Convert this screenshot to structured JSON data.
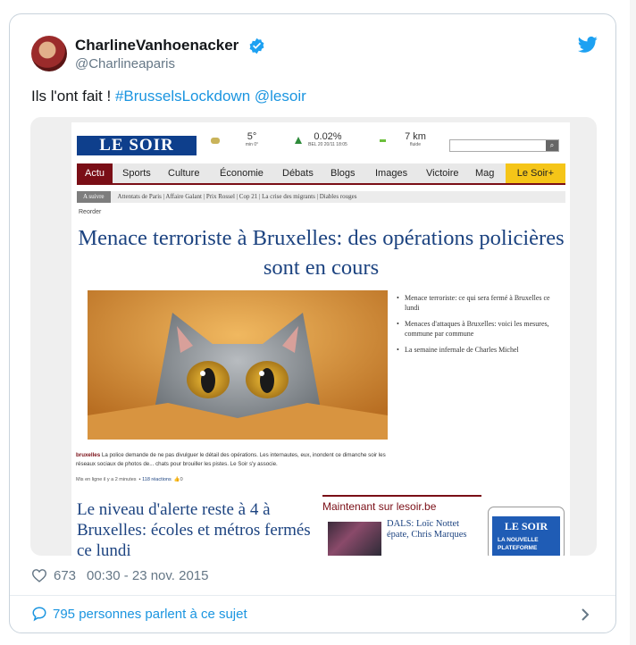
{
  "tweet": {
    "author_name": "CharlineVanhoenacker",
    "handle": "@Charlineaparis",
    "text_prefix": "Ils l'ont fait ! ",
    "hashtag": "#BrusselsLockdown",
    "mention": "@lesoir",
    "like_count": "673",
    "timestamp": "00:30 - 23 nov. 2015",
    "conversation_label": "795 personnes parlent à ce sujet",
    "icons": [
      "verified-badge-icon",
      "twitter-bird-icon",
      "heart-icon",
      "speech-bubble-icon",
      "chevron-right-icon"
    ],
    "colors": {
      "link": "#1b95e0",
      "text": "#14171a",
      "muted": "#657786"
    }
  },
  "screenshot": {
    "logo": "LE SOIR",
    "weather": {
      "temp": "5°",
      "temp_sub": "min 0°",
      "index": "0.02%",
      "index_sub": "BEL 20 20/11 18:05",
      "wind": "7 km",
      "wind_sub": "fluide"
    },
    "nav": [
      "Actu",
      "Sports",
      "Culture",
      "Économie",
      "Débats",
      "Blogs",
      "Images",
      "Victoire",
      "Mag",
      "Le Soir+"
    ],
    "crumbs_label": "A suivre",
    "crumbs": "Attentats de Paris  |  Affaire Galant  |  Prix Rossel  |  Cop 21  |  La crise des migrants  |  Diables rouges",
    "reorder": "Reorder",
    "headline": "Menace terroriste à Bruxelles: des opérations policières sont en cours",
    "related": [
      "Menace terroriste: ce qui sera fermé à Bruxelles ce lundi",
      "Menaces d'attaques à Bruxelles: voici les mesures, commune par commune",
      "La semaine infernale de Charles Michel"
    ],
    "caption_label": "bruxelles",
    "caption": " La police demande de ne pas divulguer le détail des opérations. Les internautes, eux, inondent ce dimanche soir les réseaux sociaux de photos de... chats pour brouiller les pistes. Le Soir s'y associe.",
    "meta_time": "Mis en ligne il y a 2 minutes",
    "meta_reactions": "118 réactions",
    "meta_likes": "0",
    "headline2": "Le niveau d'alerte reste à 4 à Bruxelles: écoles et métros fermés ce lundi",
    "now_on": "Maintenant sur lesoir.be",
    "dals": "DALS: Loïc Nottet épate, Chris Marques",
    "tablet_logo": "LE SOIR",
    "tablet_text": "LA NOUVELLE PLATEFORME"
  }
}
